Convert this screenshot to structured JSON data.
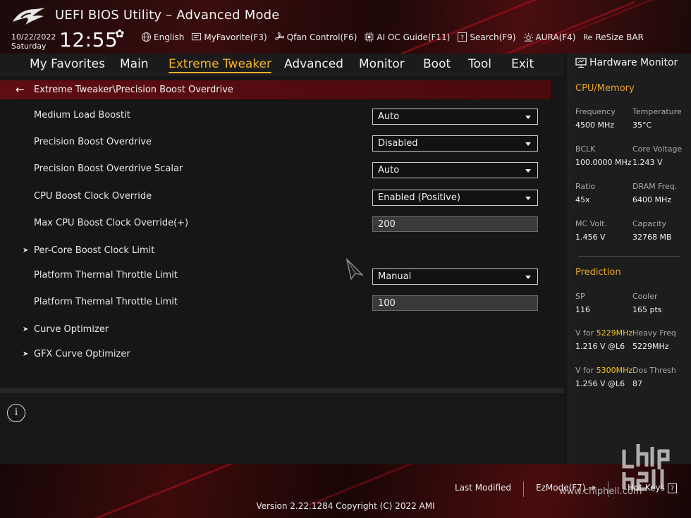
{
  "header": {
    "title": "UEFI BIOS Utility – Advanced Mode",
    "date": "10/22/2022",
    "weekday": "Saturday",
    "time": "12:55",
    "toolbar": [
      {
        "label": "English",
        "icon": "globe-icon"
      },
      {
        "label": "MyFavorite(F3)",
        "icon": "favorite-icon"
      },
      {
        "label": "Qfan Control(F6)",
        "icon": "fan-icon"
      },
      {
        "label": "AI OC Guide(F11)",
        "icon": "ai-chip-icon"
      },
      {
        "label": "Search(F9)",
        "icon": "search-icon"
      },
      {
        "label": "AURA(F4)",
        "icon": "aura-light-icon"
      },
      {
        "label": "ReSize BAR",
        "icon": "resize-bar-icon"
      }
    ]
  },
  "nav": {
    "tabs": [
      "My Favorites",
      "Main",
      "Extreme Tweaker",
      "Advanced",
      "Monitor",
      "Boot",
      "Tool",
      "Exit"
    ],
    "active": "Extreme Tweaker"
  },
  "breadcrumb": "Extreme Tweaker\\Precision Boost Overdrive",
  "settings": [
    {
      "label": "Medium Load Boostit",
      "type": "dropdown",
      "value": "Auto"
    },
    {
      "label": "Precision Boost Overdrive",
      "type": "dropdown",
      "value": "Disabled"
    },
    {
      "label": "Precision Boost Overdrive Scalar",
      "type": "dropdown",
      "value": "Auto"
    },
    {
      "label": "CPU Boost Clock Override",
      "type": "dropdown",
      "value": "Enabled (Positive)"
    },
    {
      "label": "Max CPU Boost Clock Override(+)",
      "type": "text",
      "value": "200"
    },
    {
      "label": "Per-Core Boost Clock Limit",
      "type": "submenu"
    },
    {
      "label": "Platform Thermal Throttle Limit",
      "type": "dropdown",
      "value": "Manual"
    },
    {
      "label": "Platform Thermal Throttle Limit",
      "type": "text",
      "value": "100"
    },
    {
      "label": "Curve Optimizer",
      "type": "submenu"
    },
    {
      "label": "GFX Curve Optimizer",
      "type": "submenu"
    }
  ],
  "hardware_monitor": {
    "title": "Hardware Monitor",
    "cpu_memory": {
      "heading": "CPU/Memory",
      "items": [
        {
          "label": "Frequency",
          "value": "4500 MHz"
        },
        {
          "label": "Temperature",
          "value": "35°C"
        },
        {
          "label": "BCLK",
          "value": "100.0000 MHz"
        },
        {
          "label": "Core Voltage",
          "value": "1.243 V"
        },
        {
          "label": "Ratio",
          "value": "45x"
        },
        {
          "label": "DRAM Freq.",
          "value": "6400 MHz"
        },
        {
          "label": "MC Volt.",
          "value": "1.456 V"
        },
        {
          "label": "Capacity",
          "value": "32768 MB"
        }
      ]
    },
    "prediction": {
      "heading": "Prediction",
      "sp_label": "SP",
      "sp_value": "116",
      "cooler_label": "Cooler",
      "cooler_value": "165 pts",
      "v1_prefix": "V for ",
      "v1_freq": "5229MHz",
      "v1_value": "1.216 V @L6",
      "heavy_label": "Heavy Freq",
      "heavy_value": "5229MHz",
      "v2_prefix": "V for ",
      "v2_freq": "5300MHz",
      "v2_value": "1.256 V @L6",
      "dos_label": "Dos Thresh",
      "dos_value": "87"
    }
  },
  "footer": {
    "last_modified": "Last Modified",
    "ezmode": "EzMode(F7)",
    "hotkeys": "Hot Keys",
    "version": "Version 2.22.1284 Copyright (C) 2022 AMI"
  },
  "watermark": "www.chiphell.com",
  "colors": {
    "accent": "#f5b12b",
    "breadcrumb": "#5e0d12",
    "highlight": "#f5c518"
  }
}
